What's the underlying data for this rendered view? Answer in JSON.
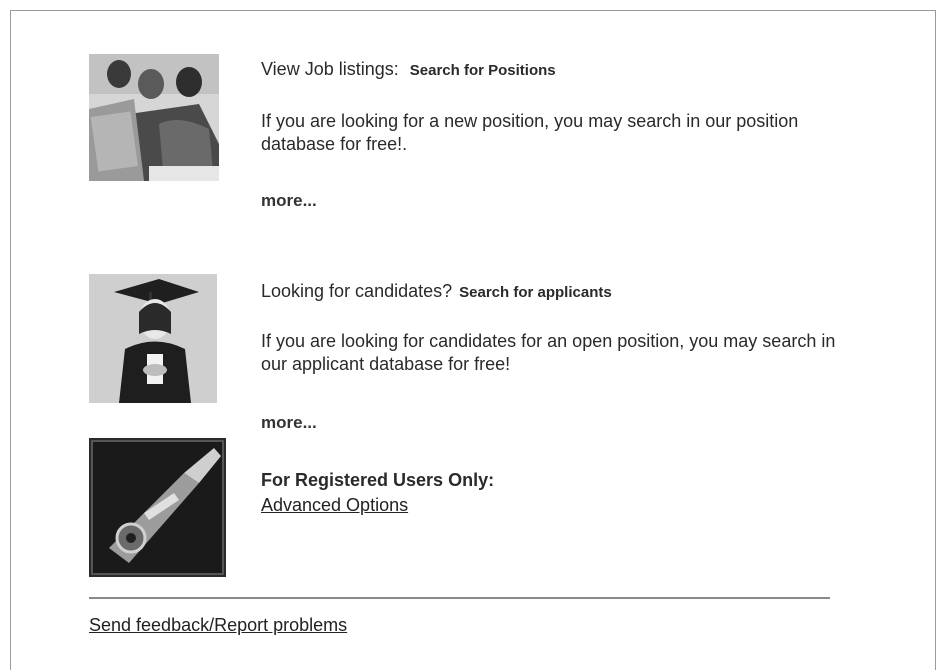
{
  "section_jobs": {
    "heading": "View Job listings:",
    "link": "Search for Positions",
    "description": "If you are looking for a new position, you may search in our position database for free!.",
    "more": "more..."
  },
  "section_candidates": {
    "heading": "Looking for candidates?",
    "link": "Search for applicants",
    "description": "If you are looking for candidates for an open position, you may search in our applicant database for free!",
    "more": "more..."
  },
  "section_registered": {
    "heading": "For Registered Users Only:",
    "link": "Advanced Options"
  },
  "footer": {
    "feedback_link": "Send feedback/Report problems"
  }
}
